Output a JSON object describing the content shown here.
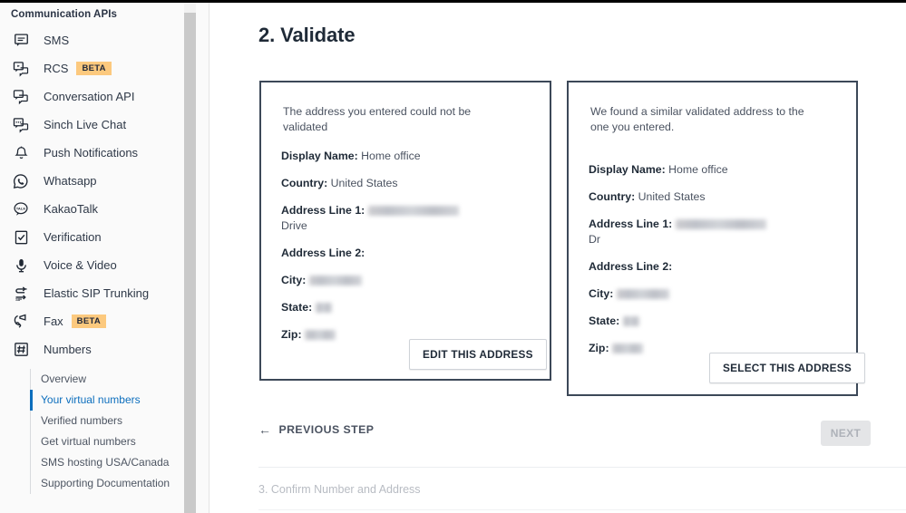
{
  "sidebar": {
    "title": "Communication APIs",
    "items": [
      {
        "label": "SMS",
        "icon": "sms-chat-icon",
        "badge": null
      },
      {
        "label": "RCS",
        "icon": "rcs-icon",
        "badge": "BETA"
      },
      {
        "label": "Conversation API",
        "icon": "conversation-icon",
        "badge": null
      },
      {
        "label": "Sinch Live Chat",
        "icon": "live-chat-icon",
        "badge": null
      },
      {
        "label": "Push Notifications",
        "icon": "bell-icon",
        "badge": null
      },
      {
        "label": "Whatsapp",
        "icon": "whatsapp-icon",
        "badge": null
      },
      {
        "label": "KakaoTalk",
        "icon": "kakaotalk-icon",
        "badge": null
      },
      {
        "label": "Verification",
        "icon": "checkbox-icon",
        "badge": null
      },
      {
        "label": "Voice & Video",
        "icon": "microphone-icon",
        "badge": null
      },
      {
        "label": "Elastic SIP Trunking",
        "icon": "sip-trunk-icon",
        "badge": null
      },
      {
        "label": "Fax",
        "icon": "fax-icon",
        "badge": "BETA"
      },
      {
        "label": "Numbers",
        "icon": "hash-number-icon",
        "badge": null
      }
    ],
    "subitems": [
      {
        "label": "Overview",
        "active": false
      },
      {
        "label": "Your virtual numbers",
        "active": true
      },
      {
        "label": "Verified numbers",
        "active": false
      },
      {
        "label": "Get virtual numbers",
        "active": false
      },
      {
        "label": "SMS hosting USA/Canada",
        "active": false
      },
      {
        "label": "Supporting Documentation",
        "active": false
      }
    ],
    "active_color": "#0c6ebd",
    "badge_color": "#fcc97e"
  },
  "main": {
    "page_title": "2. Validate",
    "card_entered": {
      "intro": "The address you entered could not be validated",
      "fields": [
        {
          "key": "Display Name:",
          "value": "Home office",
          "redacted": false
        },
        {
          "key": "Country:",
          "value": "United States",
          "redacted": false
        },
        {
          "key": "Address Line 1:",
          "value": "",
          "suffix": "Drive",
          "redacted": true,
          "redact_class": "r-addr"
        },
        {
          "key": "Address Line 2:",
          "value": "",
          "redacted": false
        },
        {
          "key": "City:",
          "value": "",
          "redacted": true,
          "redact_class": "r-city"
        },
        {
          "key": "State:",
          "value": "",
          "redacted": true,
          "redact_class": "r-state"
        },
        {
          "key": "Zip:",
          "value": "",
          "redacted": true,
          "redact_class": "r-zip"
        }
      ],
      "button_label": "EDIT THIS ADDRESS"
    },
    "card_suggested": {
      "intro": "We found a similar validated address to the one you entered.",
      "fields": [
        {
          "key": "Display Name:",
          "value": "Home office",
          "redacted": false
        },
        {
          "key": "Country:",
          "value": "United States",
          "redacted": false
        },
        {
          "key": "Address Line 1:",
          "value": "",
          "suffix": "Dr",
          "redacted": true,
          "redact_class": "r-addr"
        },
        {
          "key": "Address Line 2:",
          "value": "",
          "redacted": false
        },
        {
          "key": "City:",
          "value": "",
          "redacted": true,
          "redact_class": "r-city"
        },
        {
          "key": "State:",
          "value": "",
          "redacted": true,
          "redact_class": "r-state"
        },
        {
          "key": "Zip:",
          "value": "",
          "redacted": true,
          "redact_class": "r-zip"
        }
      ],
      "button_label": "SELECT THIS ADDRESS"
    },
    "footer": {
      "previous_label": "PREVIOUS STEP",
      "previous_arrow": "←",
      "next_label": "NEXT",
      "next_disabled": true,
      "step3_label": "3. Confirm Number and Address"
    }
  }
}
